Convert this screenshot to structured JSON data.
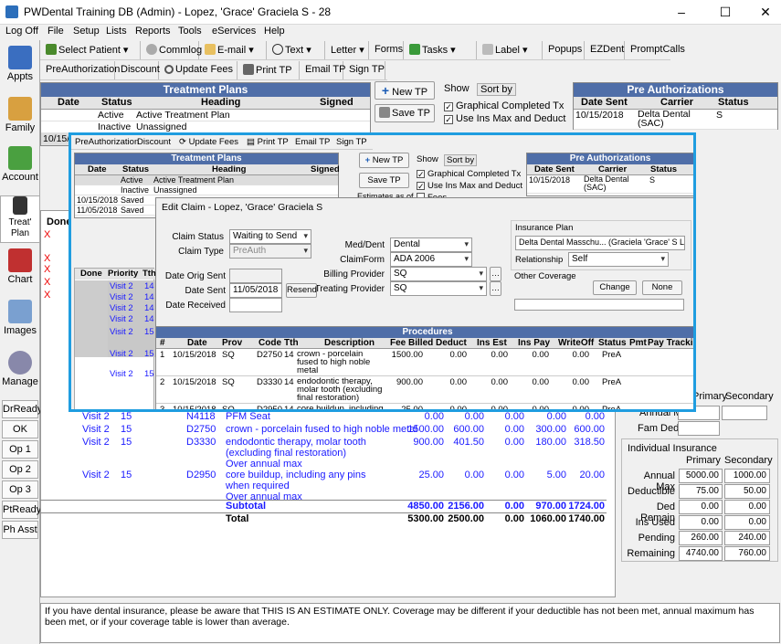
{
  "window": {
    "title": "PWDental Training DB (Admin) - Lopez, 'Grace' Graciela S - 28"
  },
  "menu": [
    "Log Off",
    "File",
    "Setup",
    "Lists",
    "Reports",
    "Tools",
    "eServices",
    "Help"
  ],
  "toolbar1": [
    "Select Patient",
    "Commlog",
    "E-mail",
    "Text",
    "Letter",
    "Forms",
    "Tasks",
    "Label",
    "Popups",
    "EZDent",
    "PromptCalls"
  ],
  "toolbar2": [
    "PreAuthorization",
    "Discount",
    "Update Fees",
    "Print TP",
    "Email TP",
    "Sign TP"
  ],
  "sidebar": [
    "Appts",
    "Family",
    "Account",
    "Treat' Plan",
    "Chart",
    "Images",
    "Manage"
  ],
  "sidebar_status": [
    "DrReady",
    "OK",
    "Op 1",
    "Op 2",
    "Op 3",
    "PtReady",
    "Ph Asst"
  ],
  "treatment_plans": {
    "title": "Treatment Plans",
    "headers": [
      "Date",
      "Status",
      "Heading",
      "Signed"
    ],
    "rows": [
      {
        "date": "",
        "status": "Active",
        "heading": "Active Treatment Plan"
      },
      {
        "date": "",
        "status": "Inactive",
        "heading": "Unassigned"
      },
      {
        "date": "10/15/2018",
        "status": "Saved",
        "heading": ""
      },
      {
        "date": "11/05/2018",
        "status": "Saved",
        "heading": ""
      }
    ]
  },
  "tp_buttons": {
    "new": "New TP",
    "save": "Save TP"
  },
  "show": {
    "tabs": [
      "Show",
      "Sort by"
    ],
    "options": [
      "Graphical Completed Tx",
      "Use Ins Max and Deduct",
      "Fees"
    ],
    "estimates_label": "Estimates as of"
  },
  "pre_auth": {
    "title": "Pre Authorizations",
    "headers": [
      "Date Sent",
      "Carrier",
      "Status"
    ],
    "rows": [
      {
        "date": "10/15/2018",
        "carrier": "Delta Dental (SAC)",
        "status": "S"
      }
    ]
  },
  "grid_headers": {
    "done": "Done",
    "priority": "Priority",
    "tth": "Tth"
  },
  "bg_rows": [
    {
      "priority": "Visit 2",
      "tth": "15",
      "code": "N4118",
      "desc": "PFM Seat",
      "fee": "0.00",
      "pri": "0.00",
      "sec": "0.00",
      "pat": "0.00",
      "alloc": "0.00"
    },
    {
      "priority": "Visit 2",
      "tth": "15",
      "code": "D2750",
      "desc": "crown - porcelain fused to high noble metal",
      "fee": "1500.00",
      "pri": "600.00",
      "sec": "0.00",
      "pat": "300.00",
      "alloc": "600.00"
    },
    {
      "priority": "Visit 2",
      "tth": "15",
      "code": "D3330",
      "desc": "endodontic therapy, molar tooth (excluding final restoration)",
      "desc2": "Over annual max",
      "fee": "900.00",
      "pri": "401.50",
      "sec": "0.00",
      "pat": "180.00",
      "alloc": "318.50"
    },
    {
      "priority": "Visit 2",
      "tth": "15",
      "code": "D2950",
      "desc": "core buildup, including any pins when required",
      "desc2": "Over annual max",
      "fee": "25.00",
      "pri": "0.00",
      "sec": "0.00",
      "pat": "5.00",
      "alloc": "20.00"
    }
  ],
  "subtotal": {
    "label": "Subtotal",
    "fee": "4850.00",
    "pri": "2156.00",
    "sec": "0.00",
    "pat": "970.00",
    "alloc": "1724.00"
  },
  "total": {
    "label": "Total",
    "fee": "5300.00",
    "pri": "2500.00",
    "sec": "0.00",
    "pat": "1060.00",
    "alloc": "1740.00"
  },
  "family_ins": {
    "primary": "Primary",
    "secondary": "Secondary",
    "annual_max": "Annual Max",
    "fam_ded": "Fam Ded"
  },
  "individual_ins": {
    "title": "Individual Insurance",
    "primary": "Primary",
    "secondary": "Secondary",
    "rows": [
      {
        "label": "Annual Max",
        "pri": "5000.00",
        "sec": "1000.00"
      },
      {
        "label": "Deductible",
        "pri": "75.00",
        "sec": "50.00"
      },
      {
        "label": "Ded Remain",
        "pri": "0.00",
        "sec": "0.00"
      },
      {
        "label": "Ins Used",
        "pri": "0.00",
        "sec": "0.00"
      },
      {
        "label": "Pending",
        "pri": "260.00",
        "sec": "240.00"
      },
      {
        "label": "Remaining",
        "pri": "4740.00",
        "sec": "760.00"
      }
    ]
  },
  "note": "If you have dental insurance, please be aware that THIS IS AN ESTIMATE ONLY.  Coverage may be different if your deductible has not been met, annual maximum has been met, or if your coverage table is lower than average.",
  "edit_claim": {
    "title": "Edit Claim - Lopez, 'Grace' Graciela S",
    "claim_status_label": "Claim Status",
    "claim_status": "Waiting to Send",
    "claim_type_label": "Claim Type",
    "claim_type": "PreAuth",
    "med_dent_label": "Med/Dent",
    "med_dent": "Dental",
    "claim_form_label": "ClaimForm",
    "claim_form": "ADA 2006",
    "billing_label": "Billing Provider",
    "billing": "SQ",
    "treating_label": "Treating Provider",
    "treating": "SQ",
    "date_orig_label": "Date Orig Sent",
    "date_orig": "",
    "date_sent_label": "Date Sent",
    "date_sent": "11/05/2018",
    "date_recv_label": "Date Received",
    "date_recv": "",
    "resend": "Resend",
    "ins_plan_label": "Insurance Plan",
    "ins_plan": "Delta Dental Masschu... (Graciela 'Grace' S Lopez)",
    "relationship_label": "Relationship",
    "relationship": "Self",
    "other_cov_label": "Other Coverage",
    "change": "Change",
    "none": "None",
    "proc_title": "Procedures",
    "proc_headers": [
      "#",
      "Date",
      "Prov",
      "Code",
      "Tth",
      "Description",
      "Fee Billed",
      "Deduct",
      "Ins Est",
      "Ins Pay",
      "WriteOff",
      "Status",
      "Pmt",
      "Pay Tracking"
    ],
    "procs": [
      {
        "n": "1",
        "date": "10/15/2018",
        "prov": "SQ",
        "code": "D2750",
        "tth": "14",
        "desc": "crown - porcelain fused to high noble metal",
        "fee": "1500.00",
        "ded": "0.00",
        "est": "0.00",
        "pay": "0.00",
        "wo": "0.00",
        "status": "PreA"
      },
      {
        "n": "2",
        "date": "10/15/2018",
        "prov": "SQ",
        "code": "D3330",
        "tth": "14",
        "desc": "endodontic therapy, molar tooth (excluding final restoration)",
        "fee": "900.00",
        "ded": "0.00",
        "est": "0.00",
        "pay": "0.00",
        "wo": "0.00",
        "status": "PreA"
      },
      {
        "n": "3",
        "date": "10/15/2018",
        "prov": "SQ",
        "code": "D2950",
        "tth": "14",
        "desc": "core buildup, including any pins when required",
        "fee": "25.00",
        "ded": "0.00",
        "est": "0.00",
        "pay": "0.00",
        "wo": "0.00",
        "status": "PreA"
      }
    ]
  },
  "popup_visits": [
    "Visit 2",
    "Visit 2",
    "Visit 2",
    "Visit 2",
    "Visit 2",
    "Visit 2",
    "Visit 2"
  ],
  "popup_tth": [
    "14",
    "14",
    "14",
    "14",
    "15",
    "15",
    "15"
  ],
  "bg_visits_top": [
    "Visit 2",
    "Visit 2"
  ],
  "bg_tth_top": [
    "15",
    "15"
  ],
  "colors": {
    "accent": "#1f9de0",
    "title_bar": "#4f6ea8",
    "link": "#1a1aff"
  }
}
